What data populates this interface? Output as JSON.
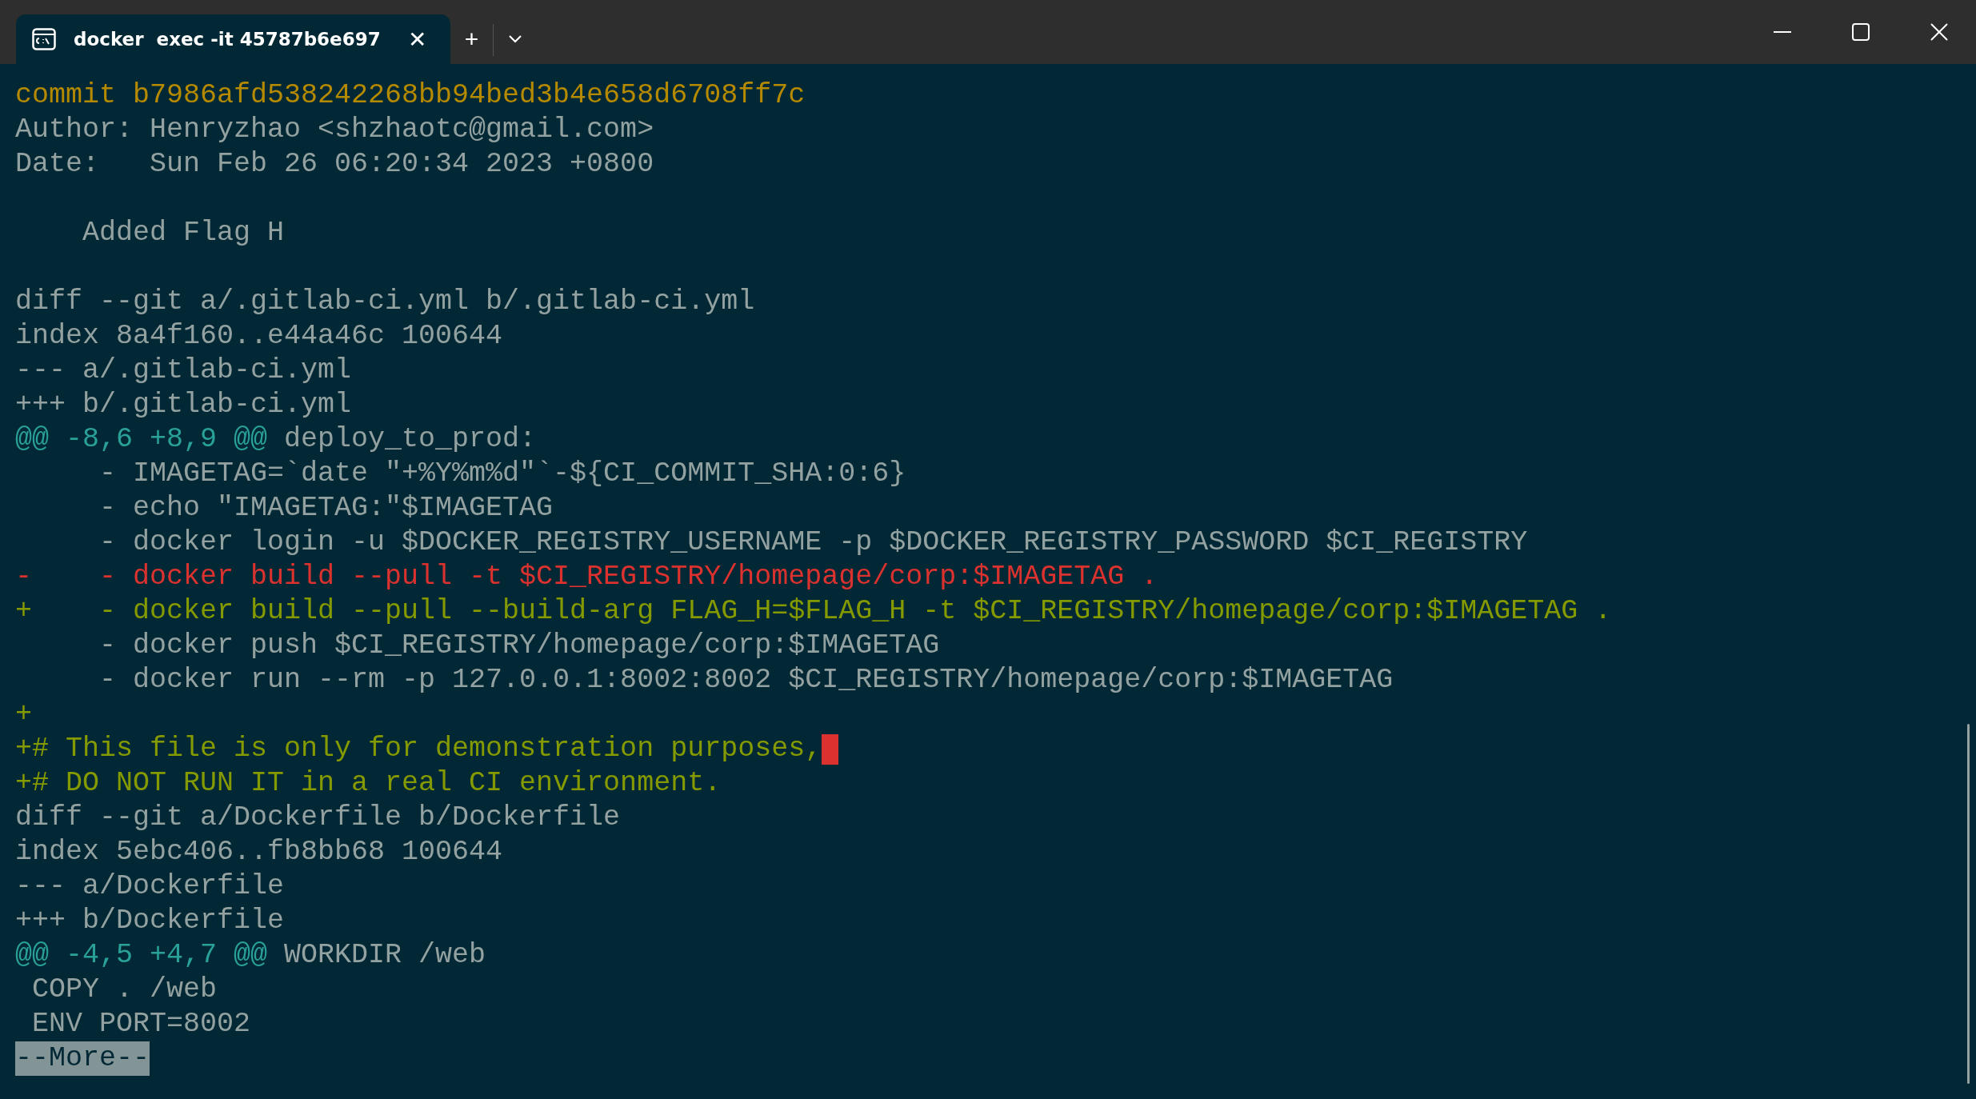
{
  "tab": {
    "title": "docker  exec -it 45787b6e697",
    "selected": true,
    "close": "✕"
  },
  "new_tab": "+",
  "lines": [
    {
      "segments": [
        {
          "kind": "commit",
          "text": "commit b7986afd538242268bb94bed3b4e658d6708ff7c"
        }
      ]
    },
    {
      "segments": [
        {
          "kind": "plain",
          "text": "Author: Henryzhao <shzhaotc@gmail.com>"
        }
      ]
    },
    {
      "segments": [
        {
          "kind": "plain",
          "text": "Date:   Sun Feb 26 06:20:34 2023 +0800"
        }
      ]
    },
    {
      "kind": "blank"
    },
    {
      "segments": [
        {
          "kind": "plain",
          "text": "    Added Flag H"
        }
      ]
    },
    {
      "kind": "blank"
    },
    {
      "segments": [
        {
          "kind": "plain",
          "text": "diff --git a/.gitlab-ci.yml b/.gitlab-ci.yml"
        }
      ]
    },
    {
      "segments": [
        {
          "kind": "plain",
          "text": "index 8a4f160..e44a46c 100644"
        }
      ]
    },
    {
      "segments": [
        {
          "kind": "plain",
          "text": "--- a/.gitlab-ci.yml"
        }
      ]
    },
    {
      "segments": [
        {
          "kind": "plain",
          "text": "+++ b/.gitlab-ci.yml"
        }
      ]
    },
    {
      "segments": [
        {
          "kind": "hunk",
          "text": "@@ -8,6 +8,9 @@"
        },
        {
          "kind": "plain",
          "text": " deploy_to_prod:"
        }
      ]
    },
    {
      "segments": [
        {
          "kind": "plain",
          "text": "     - IMAGETAG=`date \"+%Y%m%d\"`-${CI_COMMIT_SHA:0:6}"
        }
      ]
    },
    {
      "segments": [
        {
          "kind": "plain",
          "text": "     - echo \"IMAGETAG:\"$IMAGETAG"
        }
      ]
    },
    {
      "segments": [
        {
          "kind": "plain",
          "text": "     - docker login -u $DOCKER_REGISTRY_USERNAME -p $DOCKER_REGISTRY_PASSWORD $CI_REGISTRY"
        }
      ]
    },
    {
      "segments": [
        {
          "kind": "removed",
          "text": "-    - docker build --pull -t $CI_REGISTRY/homepage/corp:$IMAGETAG ."
        }
      ]
    },
    {
      "segments": [
        {
          "kind": "added",
          "text": "+    - docker build --pull --build-arg FLAG_H=$FLAG_H -t $CI_REGISTRY/homepage/corp:$IMAGETAG ."
        }
      ]
    },
    {
      "segments": [
        {
          "kind": "plain",
          "text": "     - docker push $CI_REGISTRY/homepage/corp:$IMAGETAG"
        }
      ]
    },
    {
      "segments": [
        {
          "kind": "plain",
          "text": "     - docker run --rm -p 127.0.0.1:8002:8002 $CI_REGISTRY/homepage/corp:$IMAGETAG"
        }
      ]
    },
    {
      "segments": [
        {
          "kind": "added",
          "text": "+"
        }
      ]
    },
    {
      "segments": [
        {
          "kind": "added",
          "text": "+# This file is only for demonstration purposes,"
        }
      ],
      "cursor": true
    },
    {
      "segments": [
        {
          "kind": "added",
          "text": "+# DO NOT RUN IT in a real CI environment."
        }
      ]
    },
    {
      "segments": [
        {
          "kind": "plain",
          "text": "diff --git a/Dockerfile b/Dockerfile"
        }
      ]
    },
    {
      "segments": [
        {
          "kind": "plain",
          "text": "index 5ebc406..fb8bb68 100644"
        }
      ]
    },
    {
      "segments": [
        {
          "kind": "plain",
          "text": "--- a/Dockerfile"
        }
      ]
    },
    {
      "segments": [
        {
          "kind": "plain",
          "text": "+++ b/Dockerfile"
        }
      ]
    },
    {
      "segments": [
        {
          "kind": "hunk",
          "text": "@@ -4,5 +4,7 @@"
        },
        {
          "kind": "plain",
          "text": " WORKDIR /web"
        }
      ]
    },
    {
      "segments": [
        {
          "kind": "plain",
          "text": " COPY . /web"
        }
      ]
    },
    {
      "segments": [
        {
          "kind": "plain",
          "text": " ENV PORT=8002"
        }
      ]
    },
    {
      "segments": [
        {
          "kind": "more",
          "text": "--More--"
        }
      ]
    }
  ]
}
